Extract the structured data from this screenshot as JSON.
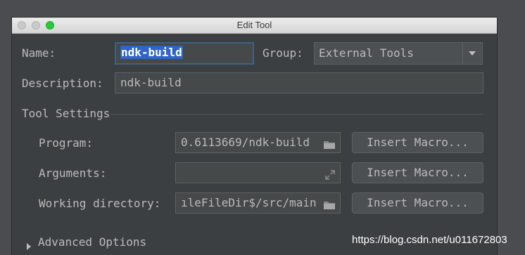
{
  "window": {
    "title": "Edit Tool"
  },
  "form": {
    "name_label": "Name:",
    "name_value": "ndk-build",
    "group_label": "Group:",
    "group_value": "External Tools",
    "description_label": "Description:",
    "description_value": "ndk-build"
  },
  "tool_settings": {
    "title": "Tool Settings",
    "program_label": "Program:",
    "program_value": "0.6113669/ndk-build",
    "arguments_label": "Arguments:",
    "arguments_value": "",
    "working_dir_label": "Working directory:",
    "working_dir_value": "ıleFileDir$/src/main",
    "insert_macro_label": "Insert Macro..."
  },
  "advanced": {
    "label": "Advanced Options"
  },
  "watermark": "https://blog.csdn.net/u011672803",
  "colors": {
    "background": "#3c3f41",
    "field": "#45494a",
    "selection": "#2f65ca",
    "focus_border": "#3d6185",
    "maximize_button": "#27c93f"
  },
  "icons": {
    "folder": "folder-icon",
    "expand": "expand-icon",
    "dropdown": "chevron-down-icon",
    "disclosure": "triangle-right-icon"
  }
}
